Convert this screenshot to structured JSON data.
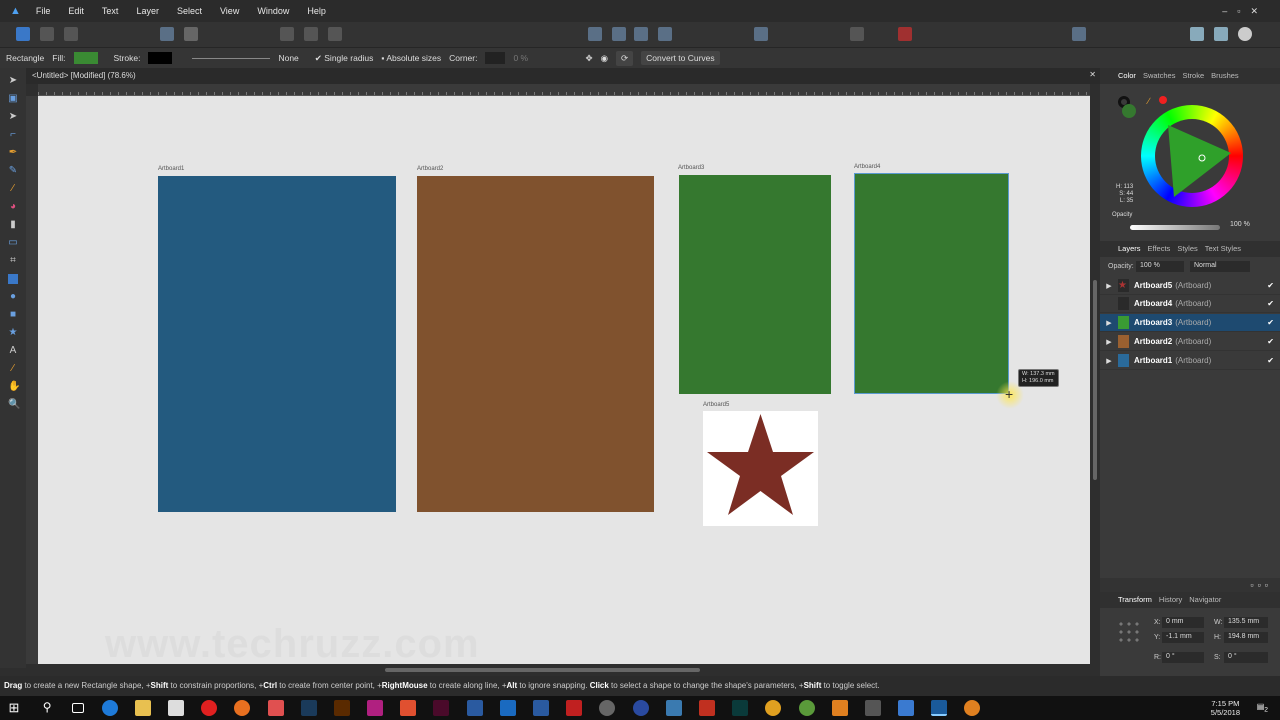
{
  "menu": [
    "File",
    "Edit",
    "Text",
    "Layer",
    "Select",
    "View",
    "Window",
    "Help"
  ],
  "context": {
    "tool": "Rectangle",
    "fill_label": "Fill:",
    "fill_color": "#3a8a33",
    "stroke_label": "Stroke:",
    "stroke_color": "#000000",
    "stroke_style": "None",
    "single_radius": "Single radius",
    "absolute_sizes": "Absolute sizes",
    "corner_label": "Corner:",
    "corner_value": "0 %",
    "convert": "Convert to Curves"
  },
  "document": {
    "title": "<Untitled> [Modified] (78.6%)"
  },
  "artboards": [
    {
      "label": "Artboard1",
      "color": "#235a7f"
    },
    {
      "label": "Artboard2",
      "color": "#80522e"
    },
    {
      "label": "Artboard3",
      "color": "#35782f"
    },
    {
      "label": "Artboard4",
      "color": "#35782f"
    },
    {
      "label": "Artboard5",
      "color": "#ffffff",
      "star_color": "#7b2d24"
    }
  ],
  "size_tooltip": {
    "w": "W: 137.3 mm",
    "h": "H: 196.0 mm"
  },
  "watermark": "www.techruzz.com",
  "color_panel": {
    "tabs": [
      "Color",
      "Swatches",
      "Stroke",
      "Brushes"
    ],
    "h": "H: 113",
    "s": "S: 44",
    "l": "L: 35",
    "opacity_label": "Opacity",
    "opacity": "100 %"
  },
  "layers_panel": {
    "tabs": [
      "Layers",
      "Effects",
      "Styles",
      "Text Styles"
    ],
    "opacity_label": "Opacity:",
    "opacity": "100 %",
    "blend": "Normal",
    "items": [
      {
        "name": "Artboard5",
        "kind": "(Artboard)",
        "thumb": "#2a2a2a"
      },
      {
        "name": "Artboard4",
        "kind": "(Artboard)",
        "thumb": "#2a2a2a"
      },
      {
        "name": "Artboard3",
        "kind": "(Artboard)",
        "thumb": "#3a9a33"
      },
      {
        "name": "Artboard2",
        "kind": "(Artboard)",
        "thumb": "#9a6030"
      },
      {
        "name": "Artboard1",
        "kind": "(Artboard)",
        "thumb": "#2a6a9a"
      }
    ]
  },
  "transform_panel": {
    "tabs": [
      "Transform",
      "History",
      "Navigator"
    ],
    "x_label": "X:",
    "x": "0 mm",
    "y_label": "Y:",
    "y": "-1.1 mm",
    "w_label": "W:",
    "w": "135.5 mm",
    "h_label": "H:",
    "h": "194.8 mm",
    "r_label": "R:",
    "r": "0 °",
    "s_label": "S:",
    "s": "0 °"
  },
  "status": {
    "b1": "Drag",
    "t1": " to create a new Rectangle shape, +",
    "b2": "Shift",
    "t2": " to constrain proportions, +",
    "b3": "Ctrl",
    "t3": " to create from center point, +",
    "b4": "RightMouse",
    "t4": " to create along line, +",
    "b5": "Alt",
    "t5": " to ignore snapping. ",
    "b6": "Click",
    "t6": " to select a shape to change the shape's parameters, +",
    "b7": "Shift",
    "t7": " to toggle select."
  },
  "tray": {
    "time": "7:15 PM",
    "date": "5/5/2018",
    "notifications": "2"
  }
}
